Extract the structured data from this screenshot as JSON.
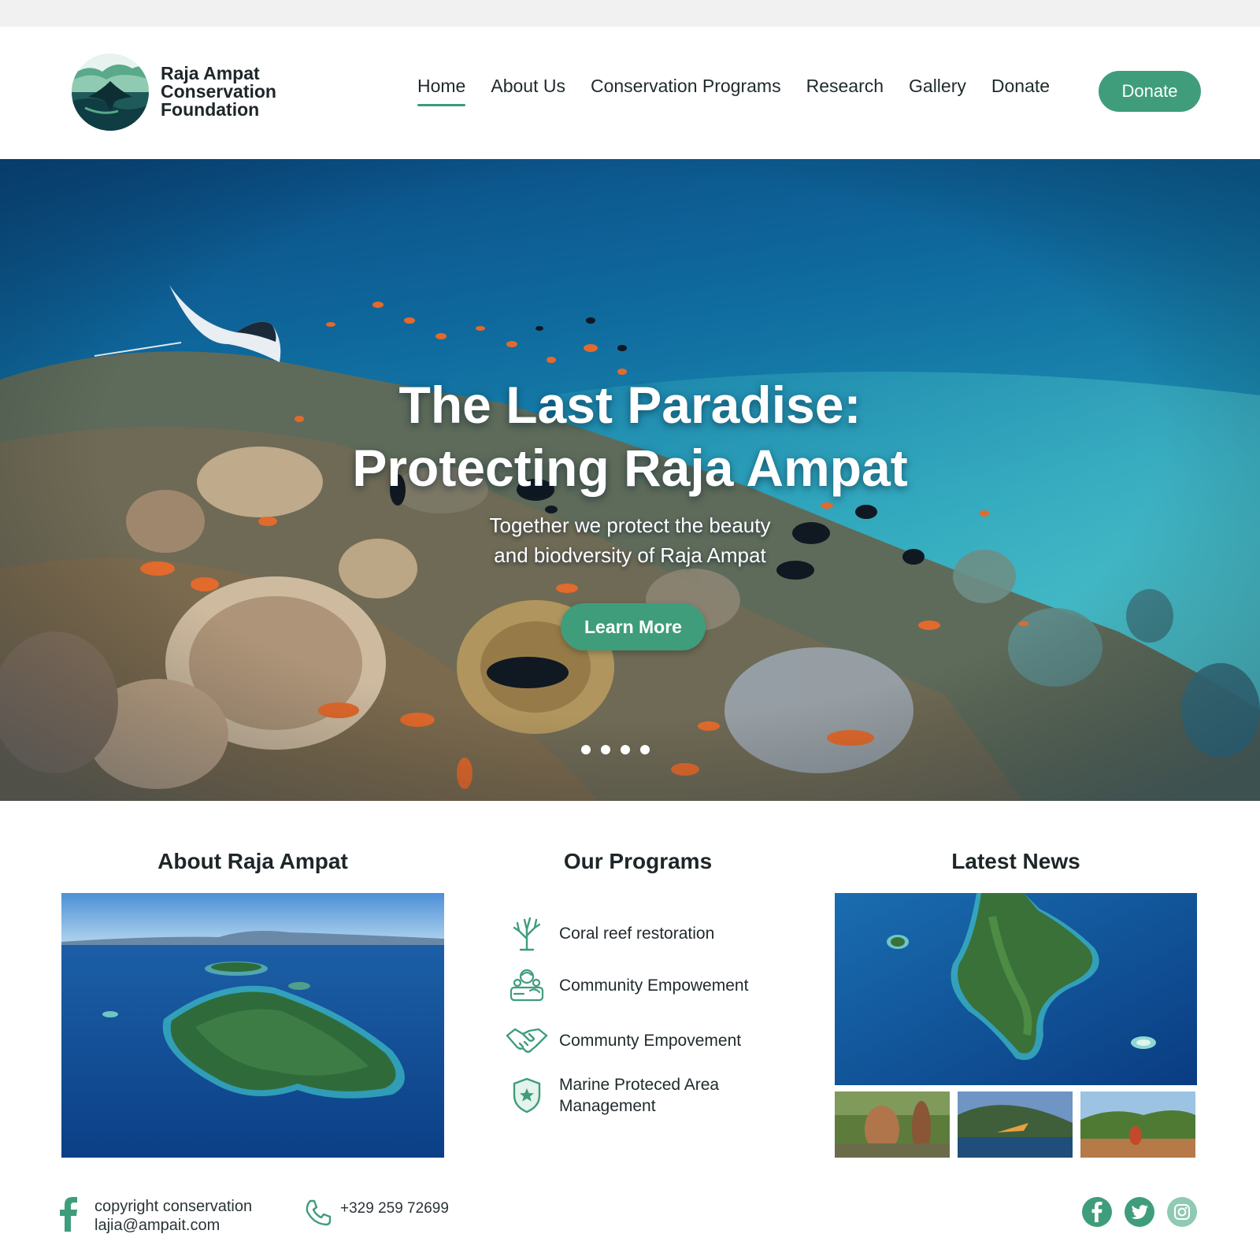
{
  "brand": {
    "line1": "Raja Ampat",
    "line2": "Conservation",
    "line3": "Foundation"
  },
  "nav": {
    "items": [
      "Home",
      "About Us",
      "Conservation Programs",
      "Research",
      "Gallery",
      "Donate"
    ],
    "active": "Home",
    "donate_button": "Donate"
  },
  "hero": {
    "title_line1": "The Last Paradise:",
    "title_line2": "Protecting Raja Ampat",
    "subtitle_line1": "Together we protect the beauty",
    "subtitle_line2": "and biodversity of Raja Ampat",
    "cta": "Learn More",
    "slide_count": 4
  },
  "about": {
    "title": "About Raja Ampat"
  },
  "programs": {
    "title": "Our Programs",
    "items": [
      {
        "icon": "coral-icon",
        "label": "Coral reef restoration"
      },
      {
        "icon": "community-icon",
        "label": "Community Empowement"
      },
      {
        "icon": "handshake-icon",
        "label": "Communty Empovement"
      },
      {
        "icon": "shield-icon",
        "label": "Marine Proteced Area Management"
      }
    ]
  },
  "news": {
    "title": "Latest News"
  },
  "footer": {
    "copy_line1": "copyright conservation",
    "copy_line2": "lajia@ampait.com",
    "phone": "+329 259 72699",
    "social": [
      "facebook-icon",
      "twitter-icon",
      "instagram-icon"
    ]
  },
  "colors": {
    "accent": "#3f9d7c",
    "ocean_deep": "#0b4f86",
    "ocean_light": "#2fb6c4",
    "text": "#1f2a2c"
  }
}
